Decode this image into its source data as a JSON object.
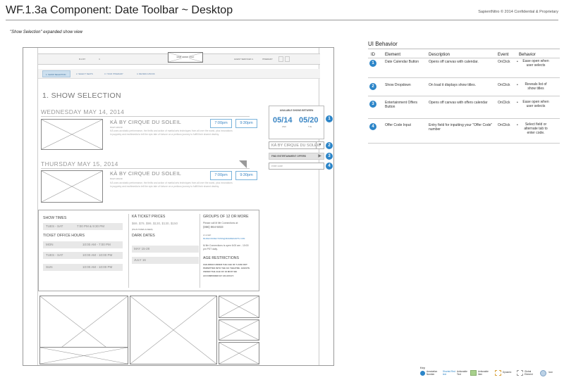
{
  "page": {
    "title": "WF.1.3a Component: Date Toolbar ~ Desktop",
    "copyright": "SapientNitro © 2014 Confidential & Proprietary",
    "subtitle": "\"Show Selection\" expanded show view"
  },
  "frame": {
    "header": {
      "left_label": "M LIST",
      "left_chevron": "∨",
      "logo_text": "MGM GRAND LOGO",
      "guest_services": "GUEST SERVICES ∨",
      "itinerary": "ITINERARY"
    },
    "steps": [
      {
        "label": "1. SHOW SELECTION",
        "active": true
      },
      {
        "label": "2. SELECT SEATS",
        "active": false
      },
      {
        "label": "3. YOUR ITINERARY",
        "active": false
      },
      {
        "label": "4. REVIEW & BOOK",
        "active": false
      }
    ],
    "section_heading": "1. SHOW SELECTION",
    "days": [
      {
        "date": "WEDNESDAY MAY 14, 2014",
        "show_title": "KÀ BY CIRQUE DU SOLEIL",
        "venue": "MGM GRAND",
        "description": "KÀ uses acrobatic performance, the thrills and action of martial arts techniques from all over the world, plus innovations in puppetry and multimedia to tell the epic tale of fortune on a perilous journey to fulfill their shared destiny.",
        "times": [
          "7:00pm",
          "9:30pm"
        ]
      },
      {
        "date": "THURSDAY MAY 15, 2014",
        "show_title": "KÀ BY CIRQUE DU SOLEIL",
        "venue": "MGM GRAND",
        "description": "KÀ uses acrobatic performance, the thrills and action of martial arts techniques from all over the world, plus innovations in puppetry and multimedia to tell the epic tale of fortune on a perilous journey to fulfill their shared destiny.",
        "times": [
          "7:00pm",
          "9:30pm"
        ]
      }
    ],
    "toolbar": {
      "available_title": "AVAILABLE SHOWS BETWEEN",
      "start_date": "05/14",
      "start_day": "WED",
      "end_date": "05/20",
      "end_day": "TUE",
      "show_dropdown_value": "KÀ BY CIRQUE DU SOLEIL",
      "dropdown_arrow": "▼",
      "offers_label": "FIND ENTERTAINMENT OFFERS",
      "offers_arrow": "▶",
      "offer_code_placeholder": "enter code"
    },
    "annotation_numbers": [
      "1",
      "2",
      "3",
      "4"
    ],
    "info": {
      "show_times_heading": "SHOW TIMES",
      "show_times_days": "TUES - SAT",
      "show_times_value": "7:00 PM & 9:30 PM",
      "box_office_heading": "TICKET OFFICE HOURS",
      "box_office": [
        {
          "days": "MON",
          "hours": "10:00 AM - 7:00 PM"
        },
        {
          "days": "TUES - SAT",
          "hours": "10:00 AM - 10:00 PM"
        },
        {
          "days": "SUN",
          "hours": "10:00 AM - 10:00 PM"
        }
      ],
      "prices_heading": "KÀ TICKET PRICES",
      "prices_value": "$69, $79, $99, $130, $130, $150",
      "prices_note": "(PLUS TAXES & FEES)",
      "dark_dates_heading": "DARK DATES",
      "dark_dates": [
        "MAY 15-28",
        "JULY 16"
      ],
      "groups_heading": "GROUPS OF 12 OR MORE",
      "groups_text": "Please call M life Connections at:",
      "groups_phone": "(866) 864-5033",
      "groups_email_label": "or email:",
      "groups_email": "MLIFECONNECTIONS@MGMRESORTS.COM",
      "groups_hours": "M life Connections is open 6:00 am - 10:00 pm PST daily.",
      "age_heading": "AGE RESTRICTIONS",
      "age_text": "CHILDREN UNDER THE AGE OF 5 ARE NOT PERMITTED INTO THE KÀ THEATRE. GUESTS UNDER THE AGE OF 18 MUST BE ACCOMPANIED BY AN ADULT."
    }
  },
  "ui_behavior": {
    "title": "UI Behavior",
    "columns": [
      "ID",
      "Element",
      "Description",
      "Event",
      "Behavior"
    ],
    "rows": [
      {
        "id": "1",
        "element": "Date Calendar Button",
        "description": "Opens off canvas with calendar.",
        "event": "OnClick",
        "behavior": "Ease open when user selects"
      },
      {
        "id": "2",
        "element": "Show Dropdown",
        "description": "On load it displays show titles.",
        "event": "OnClick",
        "behavior": "Reveals list of show titles"
      },
      {
        "id": "3",
        "element": "Entertainment Offers Button",
        "description": "Opens off canvas with offers calendar",
        "event": "OnClick",
        "behavior": "Ease open when user selects"
      },
      {
        "id": "4",
        "element": "Offer Code Input",
        "description": "Entry field for inputting your \"Offer Code\" number",
        "event": "OnClick",
        "behavior": "Select field or alternate tab to enter code."
      }
    ]
  },
  "key": {
    "label": "Key",
    "items": [
      "Annotation Number",
      "Shorted Red text",
      "Actionable Text",
      "Actionable Item",
      "Dynamic",
      "Global Element",
      "Icon"
    ]
  },
  "colors": {
    "accent": "#2c85c8",
    "time_button": "#3b86c4",
    "active_step": "#cde0ef"
  }
}
